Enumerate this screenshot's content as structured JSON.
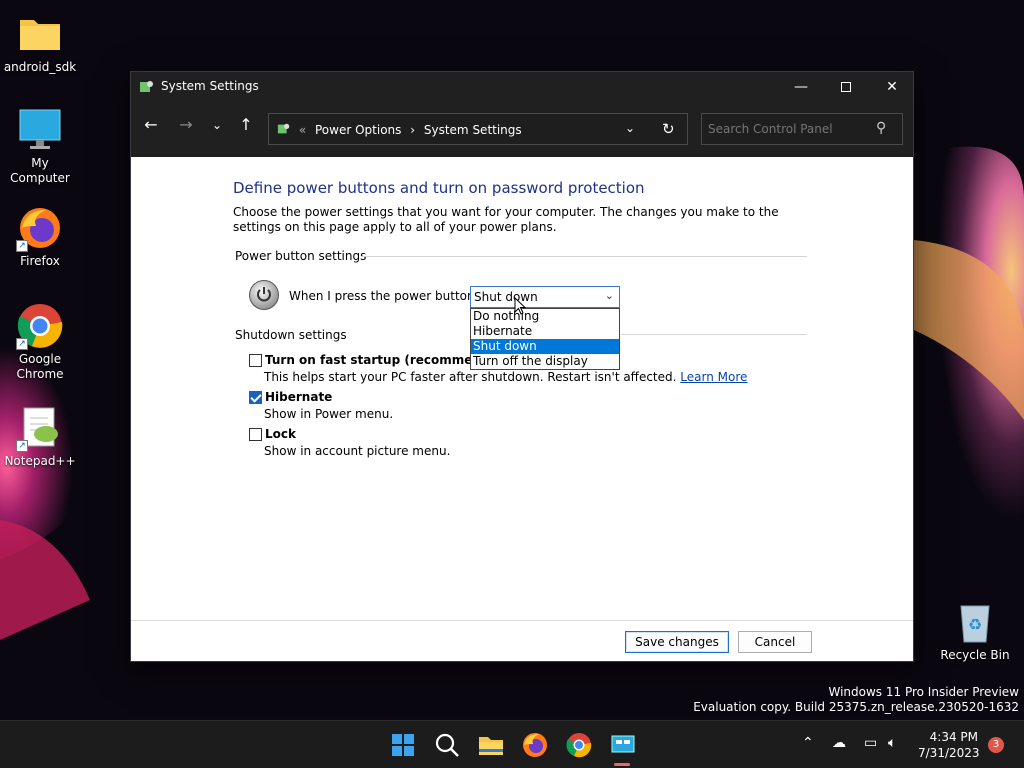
{
  "desktop": {
    "icons": [
      {
        "label": "android_sdk"
      },
      {
        "label": "My Computer"
      },
      {
        "label": "Firefox"
      },
      {
        "label": "Google Chrome"
      },
      {
        "label": "Notepad++"
      },
      {
        "label": "Recycle Bin"
      }
    ],
    "watermark": {
      "line1": "Windows 11 Pro Insider Preview",
      "line2": "Evaluation copy. Build 25375.zn_release.230520-1632"
    }
  },
  "window": {
    "title": "System Settings",
    "address": {
      "sep": "«",
      "crumbs": [
        "Power Options",
        "System Settings"
      ],
      "arrow": "›"
    },
    "search": {
      "placeholder": "Search Control Panel"
    },
    "heading": "Define power buttons and turn on password protection",
    "description": "Choose the power settings that you want for your computer. The changes you make to the settings on this page apply to all of your power plans.",
    "power_button_group": "Power button settings",
    "power_label": "When I press the power button:",
    "power_select": {
      "value": "Shut down",
      "options": [
        "Do nothing",
        "Hibernate",
        "Shut down",
        "Turn off the display"
      ],
      "selected_index": 2
    },
    "shutdown_group": "Shutdown settings",
    "checkboxes": [
      {
        "label": "Turn on fast startup (recommended)",
        "checked": false,
        "sub": "This helps start your PC faster after shutdown. Restart isn't affected.",
        "link": "Learn More"
      },
      {
        "label": "Hibernate",
        "checked": true,
        "sub": "Show in Power menu."
      },
      {
        "label": "Lock",
        "checked": false,
        "sub": "Show in account picture menu."
      }
    ],
    "buttons": {
      "save": "Save changes",
      "cancel": "Cancel"
    }
  },
  "taskbar": {
    "clock_time": "4:34 PM",
    "clock_date": "7/31/2023",
    "notification_count": "3"
  },
  "colors": {
    "accent": "#0078d7",
    "heading": "#1e3287",
    "link": "#0645ad",
    "titlebar": "#202020"
  }
}
